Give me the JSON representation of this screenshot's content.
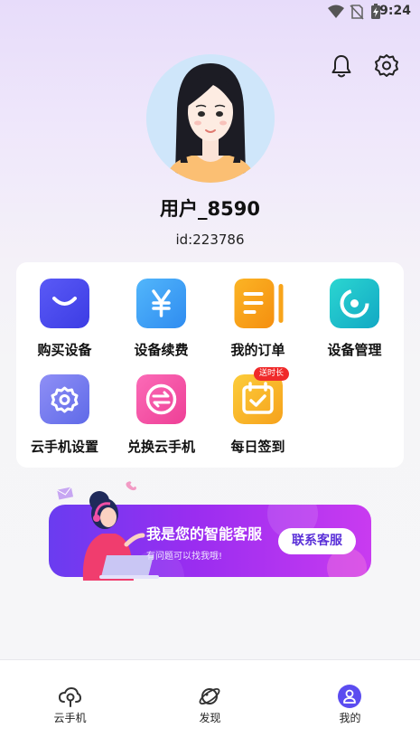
{
  "status_bar": {
    "time": "9:24",
    "icons": [
      "wifi-icon",
      "no-sim-icon",
      "battery-charging-icon"
    ]
  },
  "header": {
    "icons": [
      "bell-icon",
      "settings-gear-icon"
    ]
  },
  "profile": {
    "username": "用户_8590",
    "user_id": "id:223786"
  },
  "grid": {
    "items": [
      {
        "label": "购买设备",
        "icon": "envelope-icon",
        "color": "#4e4cf0"
      },
      {
        "label": "设备续费",
        "icon": "yen-icon",
        "color": "#3b9cf5"
      },
      {
        "label": "我的订单",
        "icon": "order-list-icon",
        "color": "#f6a11a"
      },
      {
        "label": "设备管理",
        "icon": "device-manage-icon",
        "color": "#14c1c7"
      },
      {
        "label": "云手机设置",
        "icon": "cloud-gear-icon",
        "color": "#7a7cf2"
      },
      {
        "label": "兑换云手机",
        "icon": "exchange-icon",
        "color": "#f04fa6"
      },
      {
        "label": "每日签到",
        "icon": "calendar-check-icon",
        "color": "#f8b62a",
        "badge": "送时长"
      }
    ]
  },
  "service_banner": {
    "title": "我是您的智能客服",
    "subtitle": "有问题可以找我哦!",
    "button_label": "联系客服"
  },
  "bottom_nav": {
    "items": [
      {
        "label": "云手机",
        "icon": "cloud-phone-icon",
        "active": false
      },
      {
        "label": "发现",
        "icon": "planet-icon",
        "active": false
      },
      {
        "label": "我的",
        "icon": "user-icon",
        "active": true
      }
    ],
    "active_color": "#5b4cf0"
  }
}
